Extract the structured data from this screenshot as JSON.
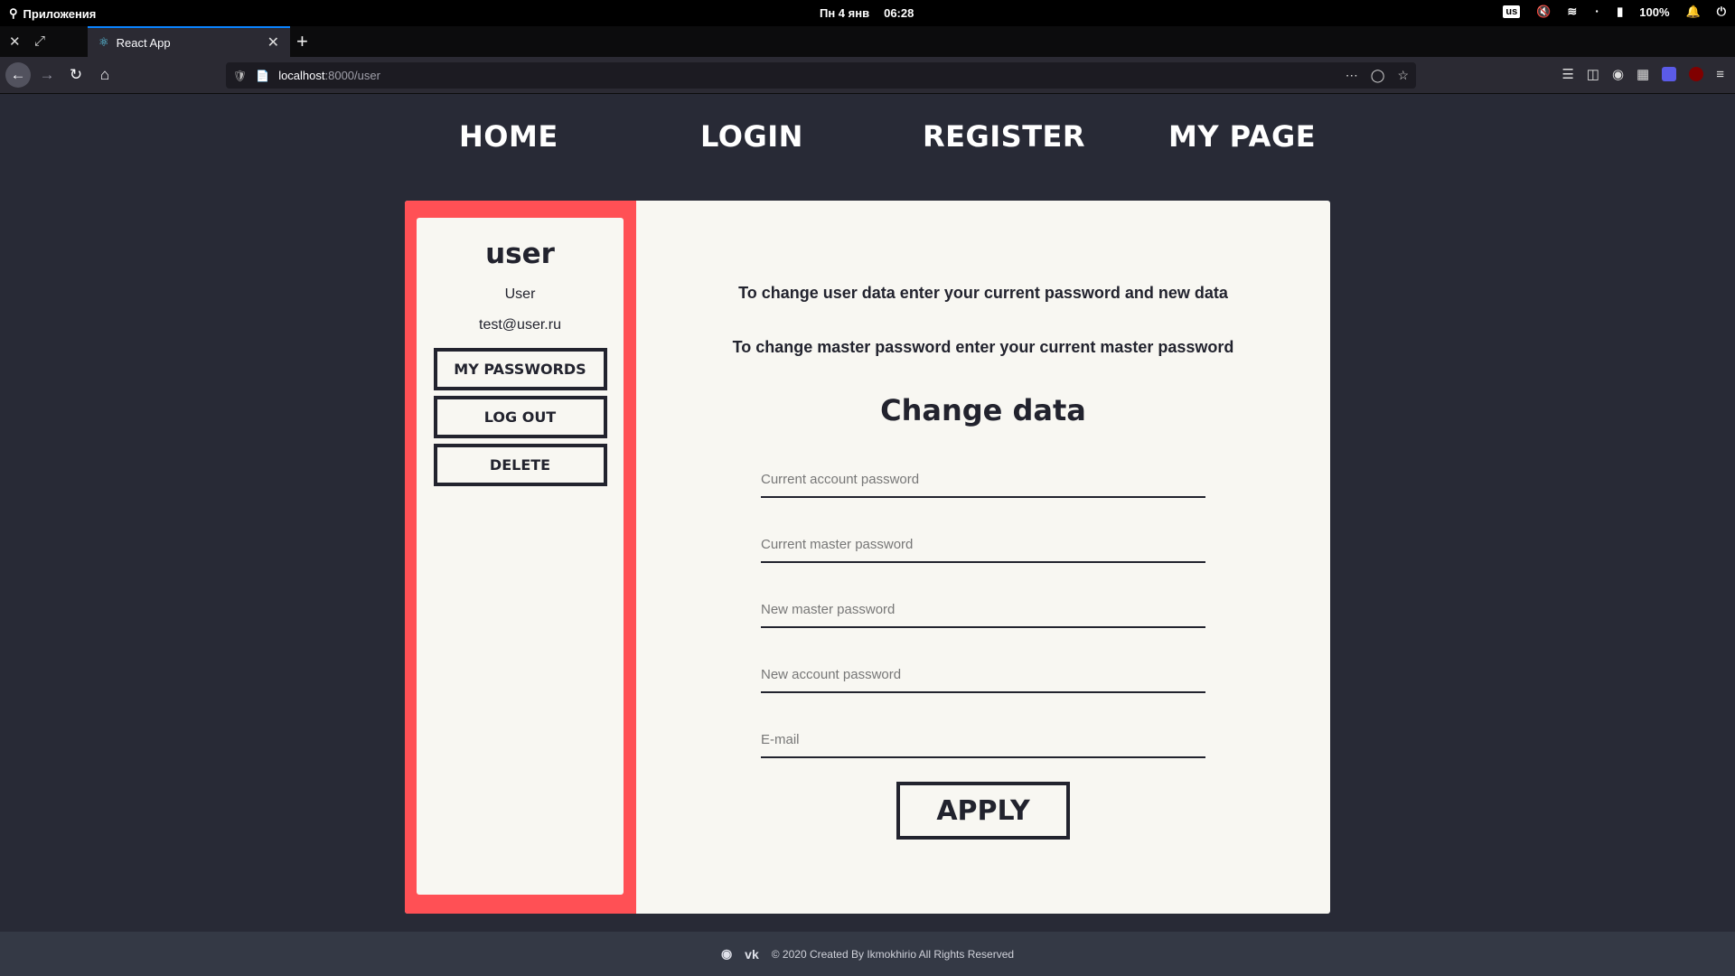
{
  "os": {
    "apps_label": "Приложения",
    "date": "Пн  4 янв",
    "time": "06:28",
    "keyboard_layout": "us",
    "battery": "100%"
  },
  "browser": {
    "tab_title": "React App",
    "url_host": "localhost",
    "url_path": ":8000/user"
  },
  "nav": {
    "home": "HOME",
    "login": "LOGIN",
    "register": "REGISTER",
    "my_page": "MY PAGE"
  },
  "sidebar": {
    "username": "user",
    "name": "User",
    "email": "test@user.ru",
    "buttons": [
      "MY PASSWORDS",
      "LOG OUT",
      "DELETE"
    ]
  },
  "main": {
    "info_1": "To change user data enter your current password and new data",
    "info_2": "To change master password enter your current master password",
    "title": "Change data",
    "fields": [
      {
        "placeholder": "Current account password"
      },
      {
        "placeholder": "Current master password"
      },
      {
        "placeholder": "New master password"
      },
      {
        "placeholder": "New account password"
      },
      {
        "placeholder": "E-mail"
      }
    ],
    "apply_label": "APPLY"
  },
  "footer": {
    "copyright": "© 2020 Created By Ikmokhirio All Rights Reserved"
  },
  "colors": {
    "background": "#282a36",
    "card": "#f8f7f2",
    "accent": "#ff5055",
    "text": "#22232e",
    "footer": "#343945"
  }
}
